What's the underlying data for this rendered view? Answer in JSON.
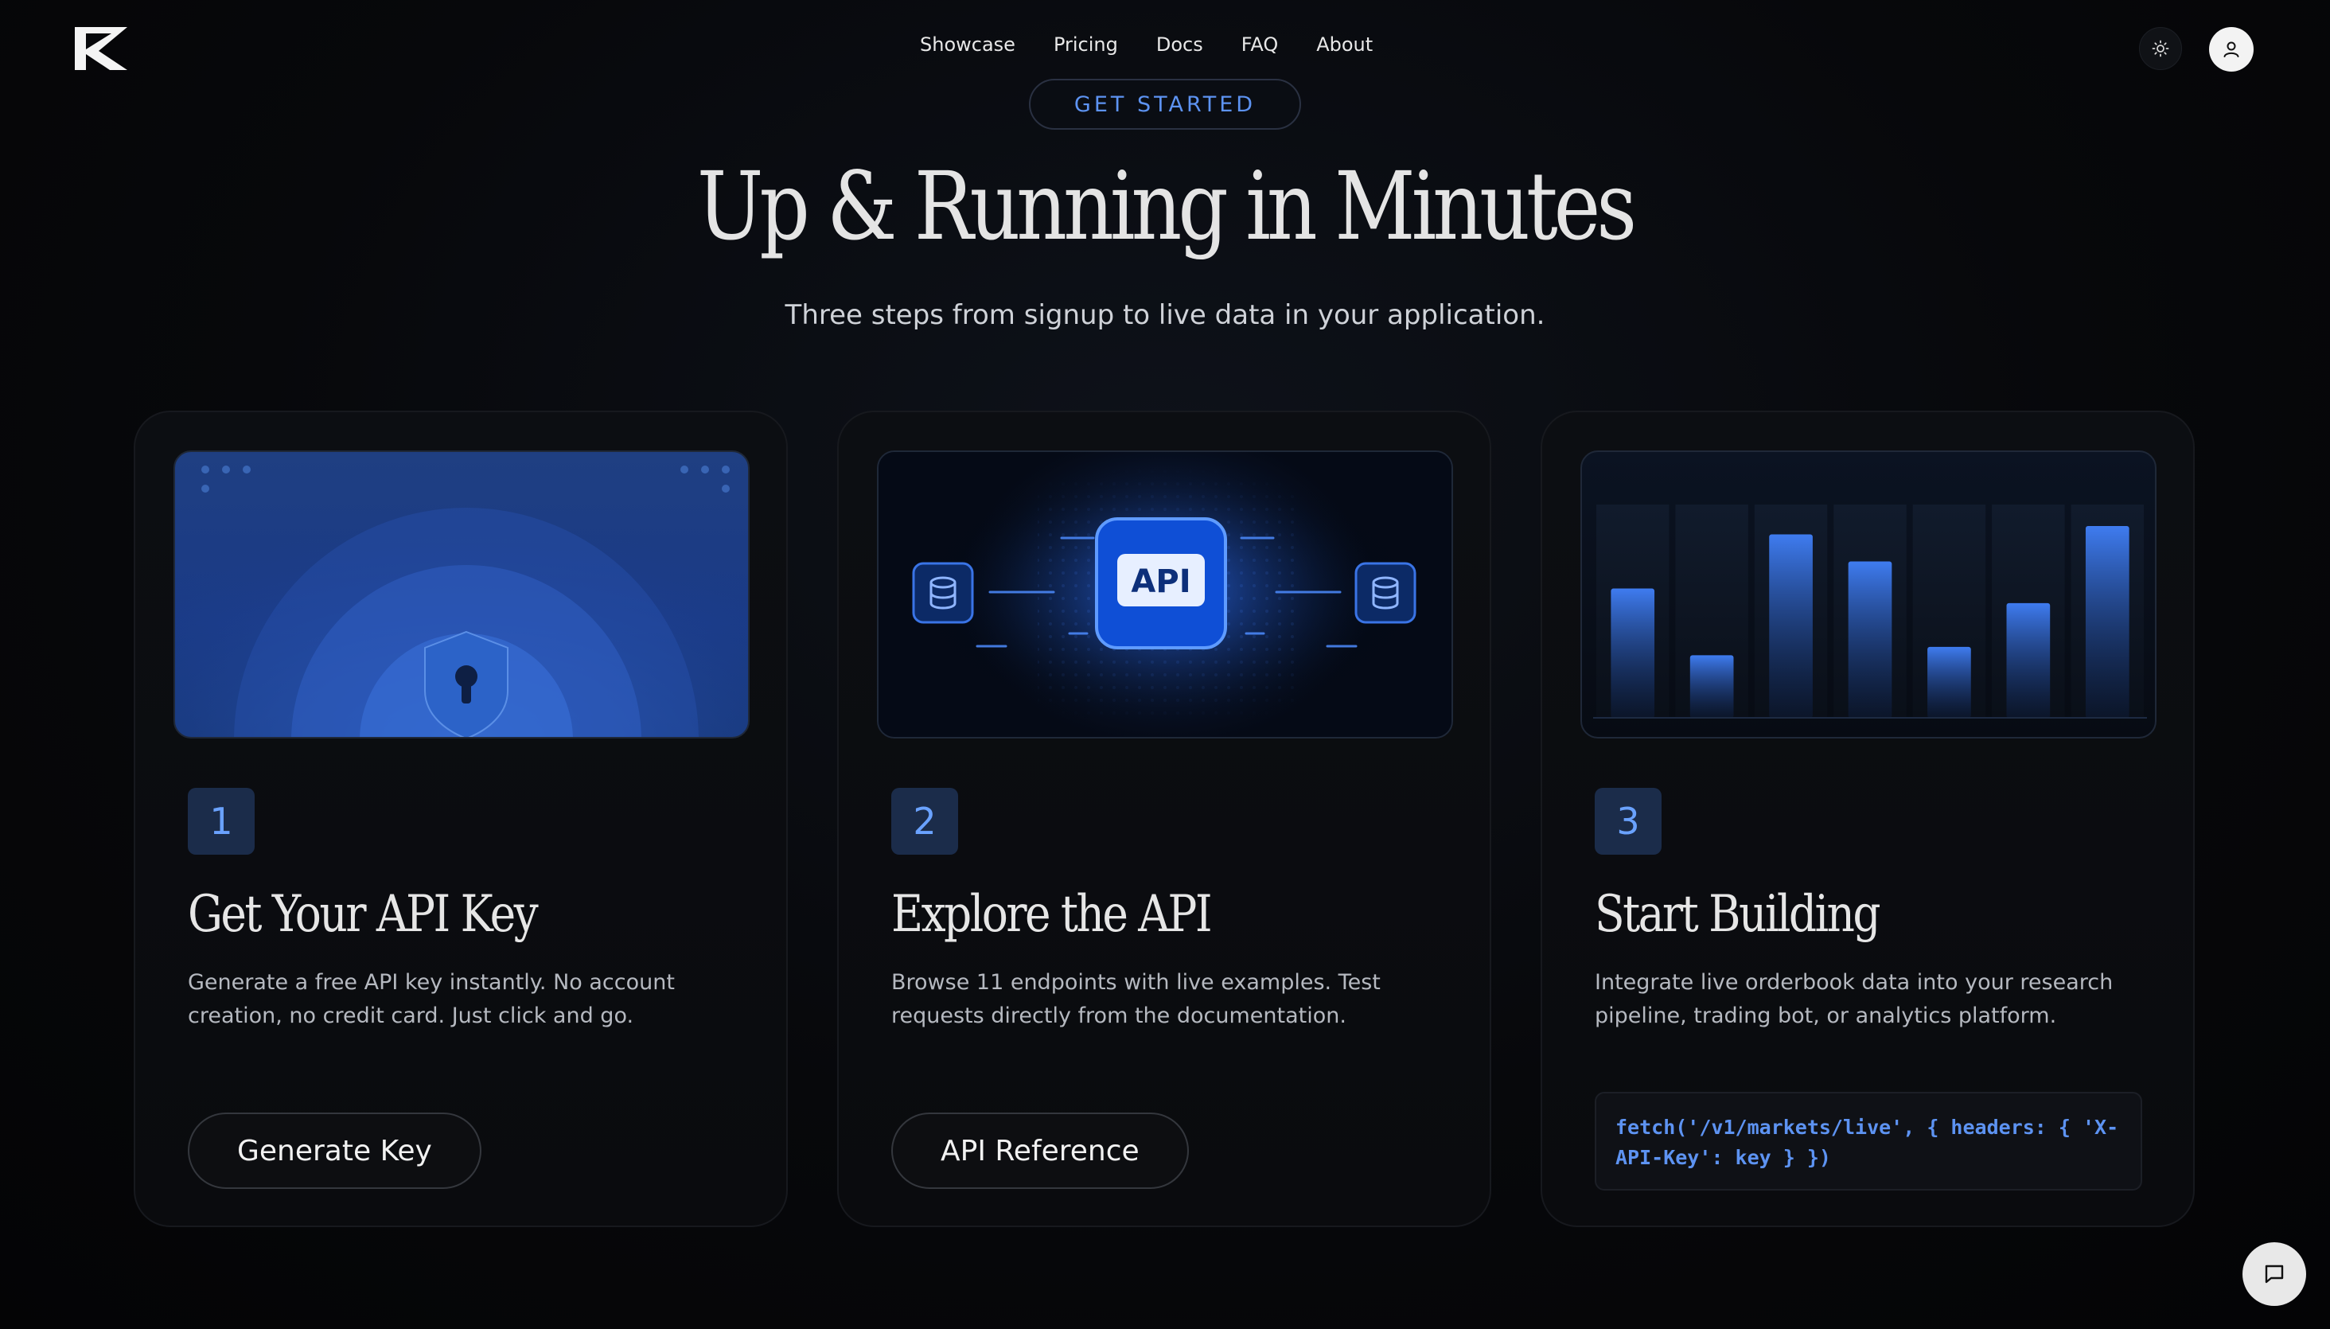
{
  "nav": {
    "items": [
      "Showcase",
      "Pricing",
      "Docs",
      "FAQ",
      "About"
    ]
  },
  "hero": {
    "badge": "GET STARTED",
    "title": "Up & Running in Minutes",
    "subtitle": "Three steps from signup to live data in your application."
  },
  "cards": [
    {
      "step": "1",
      "title": "Get Your API Key",
      "description": "Generate a free API key instantly. No account creation, no credit card. Just click and go.",
      "button": "Generate Key",
      "illustration": "shield-lock-icon"
    },
    {
      "step": "2",
      "title": "Explore the API",
      "description": "Browse 11 endpoints with live examples. Test requests directly from the documentation.",
      "button": "API Reference",
      "illustration_label": "API",
      "illustration": "database-icon"
    },
    {
      "step": "3",
      "title": "Start Building",
      "description": "Integrate live orderbook data into your research pipeline, trading bot, or analytics platform.",
      "code": "fetch('/v1/markets/live', { headers: { 'X-API-Key': key } })",
      "illustration": "bar-chart-icon",
      "bar_levels": [
        0.62,
        0.3,
        0.88,
        0.75,
        0.34,
        0.55,
        0.92
      ]
    }
  ],
  "colors": {
    "accent": "#5d93f2",
    "background": "#07080b",
    "card": "#0c0e12"
  }
}
